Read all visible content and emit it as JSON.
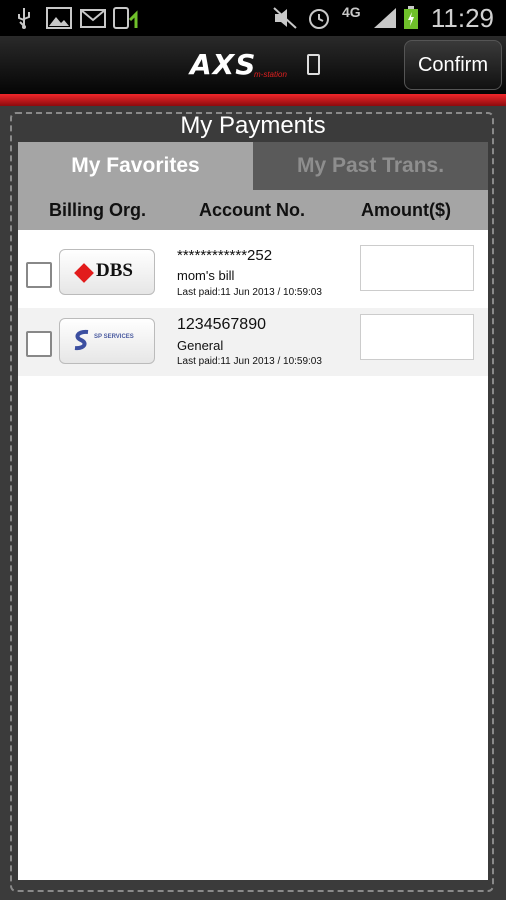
{
  "status_bar": {
    "time": "11:29",
    "network": "4G",
    "icons": [
      "usb-icon",
      "gallery-icon",
      "mail-icon",
      "sync-icon",
      "mute-icon",
      "alarm-icon",
      "signal-icon",
      "battery-charging-icon"
    ]
  },
  "header": {
    "logo_text": "AXS",
    "logo_sub": "m-station",
    "confirm_label": "Confirm"
  },
  "page": {
    "title": "My Payments"
  },
  "tabs": [
    {
      "label": "My Favorites",
      "active": true
    },
    {
      "label": "My Past Trans.",
      "active": false
    }
  ],
  "columns": [
    "Billing Org.",
    "Account No.",
    "Amount($)"
  ],
  "rows": [
    {
      "org_logo": "DBS",
      "account": "************252",
      "description": "mom's bill",
      "last_paid": "Last paid:11 Jun 2013 / 10:59:03",
      "amount": ""
    },
    {
      "org_logo": "SP SERVICES",
      "account": "1234567890",
      "description": "General",
      "last_paid": "Last paid:11 Jun 2013 / 10:59:03",
      "amount": ""
    }
  ],
  "colors": {
    "accent_red": "#e21b1b",
    "tab_active": "#a5a5a5",
    "tab_inactive": "#5a5a5a"
  }
}
